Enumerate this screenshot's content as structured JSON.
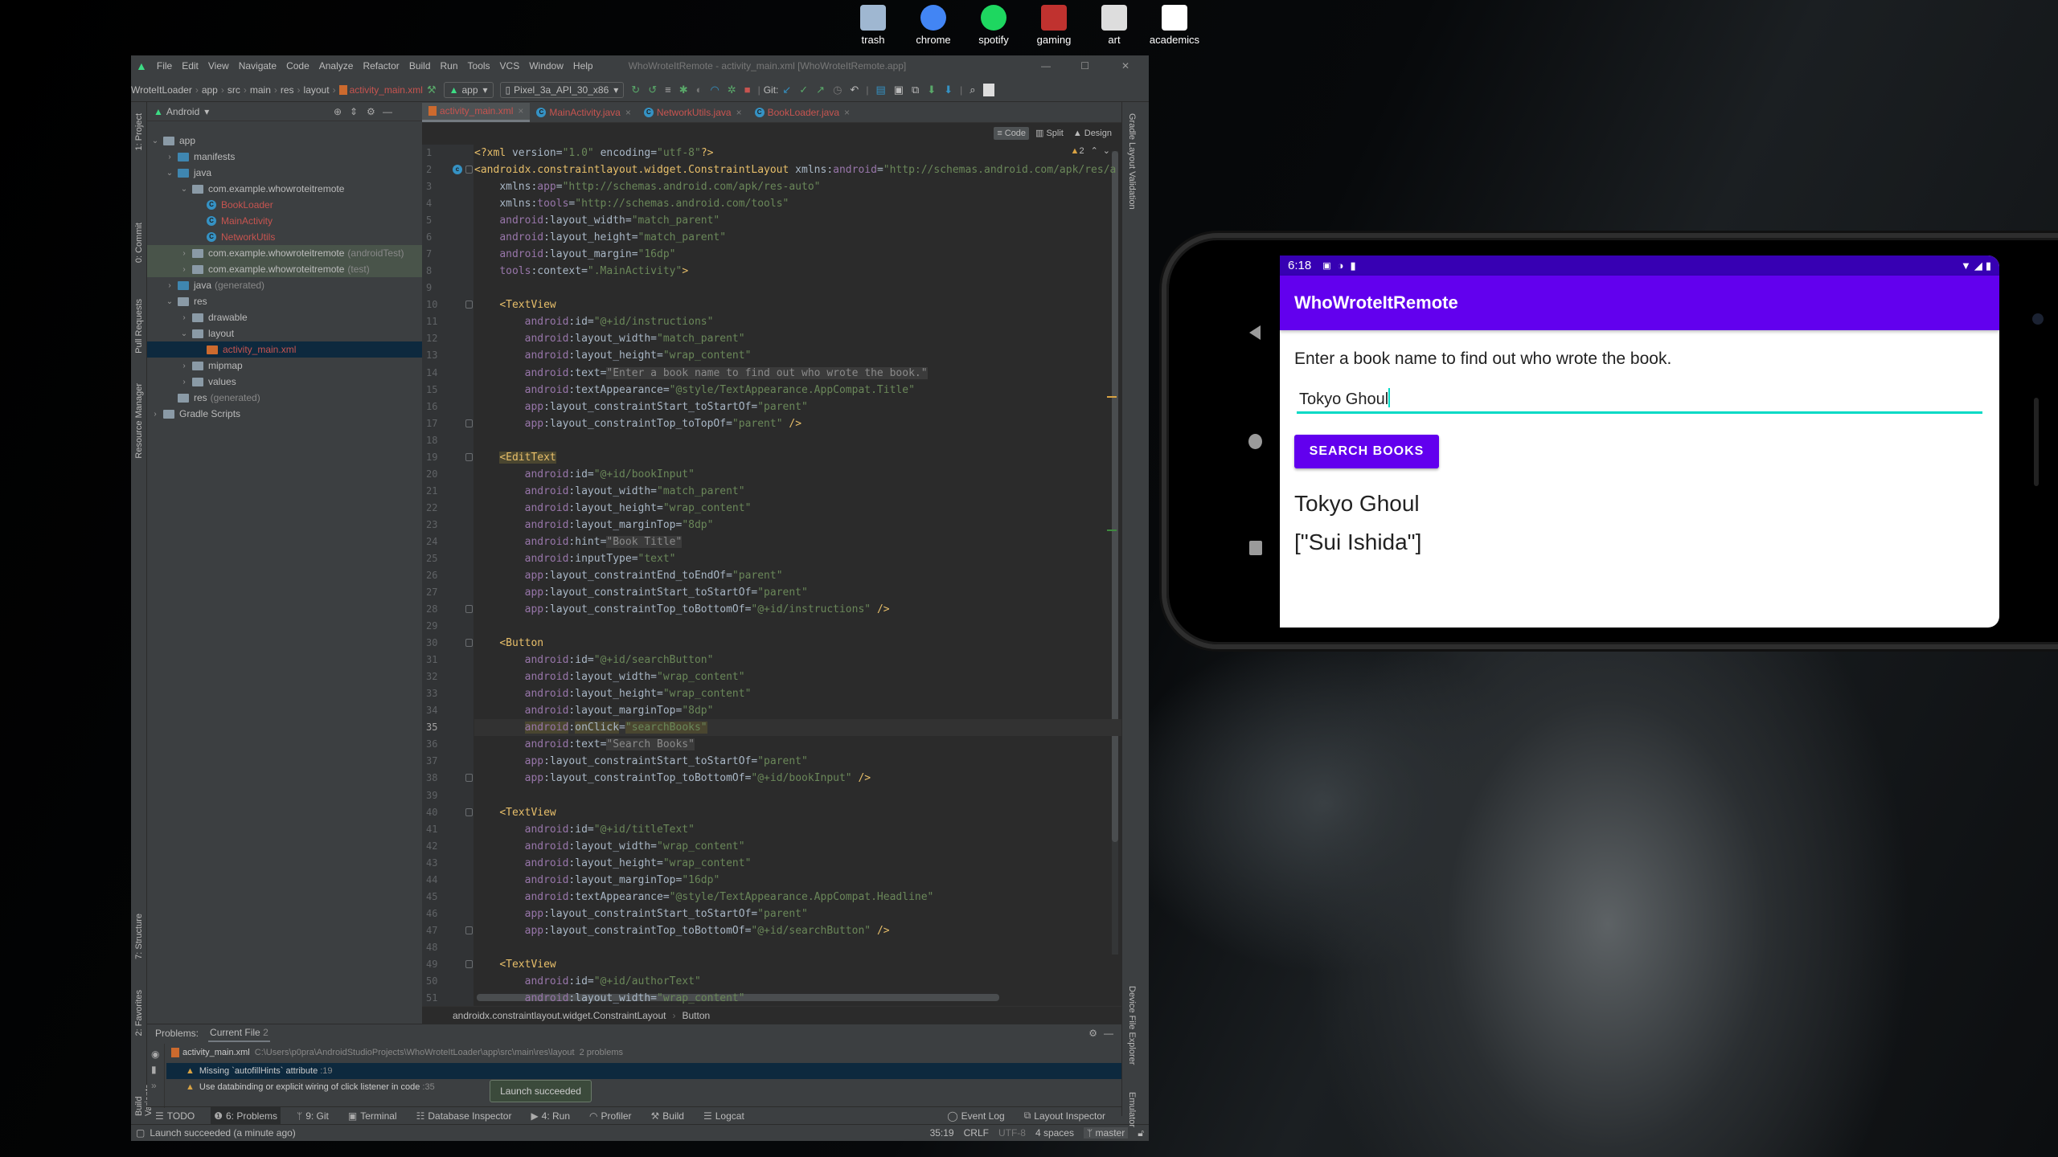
{
  "desktop": {
    "icons": [
      {
        "label": "trash",
        "color": "#9fb7d1"
      },
      {
        "label": "chrome",
        "color": "#4285f4"
      },
      {
        "label": "spotify",
        "color": "#1ed760"
      },
      {
        "label": "gaming",
        "color": "#c0322f"
      },
      {
        "label": "art",
        "color": "#dddddd"
      },
      {
        "label": "academics",
        "color": "#ffffff"
      }
    ]
  },
  "ide": {
    "window_title": "WhoWroteItRemote - activity_main.xml [WhoWroteItRemote.app]",
    "menu": [
      "File",
      "Edit",
      "View",
      "Navigate",
      "Code",
      "Analyze",
      "Refactor",
      "Build",
      "Run",
      "Tools",
      "VCS",
      "Window",
      "Help"
    ],
    "breadcrumb": [
      "WroteItLoader",
      "app",
      "src",
      "main",
      "res",
      "layout",
      "activity_main.xml"
    ],
    "run_config": "app",
    "device": "Pixel_3a_API_30_x86",
    "git_label": "Git:",
    "project_view": "Android",
    "left_strip": {
      "top": [
        "1: Project",
        "0: Commit",
        "Pull Requests",
        "Resource Manager"
      ],
      "bottom": [
        "7: Structure",
        "2: Favorites",
        "Build Variants"
      ]
    },
    "right_strip": {
      "top": [
        "Gradle",
        "Layout Validation"
      ],
      "bottom": [
        "Device File Explorer",
        "Emulator"
      ]
    },
    "tree": [
      {
        "label": "app",
        "suffix": "",
        "level": 0,
        "chev": "open",
        "icon": "module",
        "color": "#bbbbbb"
      },
      {
        "label": "manifests",
        "suffix": "",
        "level": 1,
        "chev": "closed",
        "icon": "folder",
        "color": "#bbbbbb"
      },
      {
        "label": "java",
        "suffix": "",
        "level": 1,
        "chev": "open",
        "icon": "folder",
        "color": "#bbbbbb"
      },
      {
        "label": "com.example.whowroteitremote",
        "suffix": "",
        "level": 2,
        "chev": "open",
        "icon": "package",
        "color": "#bbbbbb"
      },
      {
        "label": "BookLoader",
        "suffix": "",
        "level": 3,
        "chev": "",
        "icon": "class",
        "color": "#c75450"
      },
      {
        "label": "MainActivity",
        "suffix": "",
        "level": 3,
        "chev": "",
        "icon": "class",
        "color": "#c75450"
      },
      {
        "label": "NetworkUtils",
        "suffix": "",
        "level": 3,
        "chev": "",
        "icon": "class",
        "color": "#c75450"
      },
      {
        "label": "com.example.whowroteitremote",
        "suffix": "(androidTest)",
        "level": 2,
        "chev": "closed",
        "icon": "package",
        "color": "#bbbbbb",
        "test": true
      },
      {
        "label": "com.example.whowroteitremote",
        "suffix": "(test)",
        "level": 2,
        "chev": "closed",
        "icon": "package",
        "color": "#bbbbbb",
        "test": true
      },
      {
        "label": "java",
        "suffix": "(generated)",
        "level": 1,
        "chev": "closed",
        "icon": "folder",
        "color": "#bbbbbb"
      },
      {
        "label": "res",
        "suffix": "",
        "level": 1,
        "chev": "open",
        "icon": "res",
        "color": "#bbbbbb"
      },
      {
        "label": "drawable",
        "suffix": "",
        "level": 2,
        "chev": "closed",
        "icon": "package",
        "color": "#bbbbbb"
      },
      {
        "label": "layout",
        "suffix": "",
        "level": 2,
        "chev": "open",
        "icon": "package",
        "color": "#bbbbbb"
      },
      {
        "label": "activity_main.xml",
        "suffix": "",
        "level": 3,
        "chev": "",
        "icon": "xml",
        "color": "#c75450",
        "selected": true
      },
      {
        "label": "mipmap",
        "suffix": "",
        "level": 2,
        "chev": "closed",
        "icon": "package",
        "color": "#bbbbbb"
      },
      {
        "label": "values",
        "suffix": "",
        "level": 2,
        "chev": "closed",
        "icon": "package",
        "color": "#bbbbbb"
      },
      {
        "label": "res",
        "suffix": "(generated)",
        "level": 1,
        "chev": "",
        "icon": "res",
        "color": "#bbbbbb"
      },
      {
        "label": "Gradle Scripts",
        "suffix": "",
        "level": 0,
        "chev": "closed",
        "icon": "gradle",
        "color": "#bbbbbb"
      }
    ],
    "tabs": [
      {
        "label": "activity_main.xml",
        "icon": "xml",
        "active": true
      },
      {
        "label": "MainActivity.java",
        "icon": "class"
      },
      {
        "label": "NetworkUtils.java",
        "icon": "class"
      },
      {
        "label": "BookLoader.java",
        "icon": "class"
      }
    ],
    "view_modes": [
      "Code",
      "Split",
      "Design"
    ],
    "warning_count": "2",
    "code_lines": [
      "<?xml version=\"1.0\" encoding=\"utf-8\"?>",
      "<androidx.constraintlayout.widget.ConstraintLayout xmlns:android=\"http://schemas.android.com/apk/res/a",
      "    xmlns:app=\"http://schemas.android.com/apk/res-auto\"",
      "    xmlns:tools=\"http://schemas.android.com/tools\"",
      "    android:layout_width=\"match_parent\"",
      "    android:layout_height=\"match_parent\"",
      "    android:layout_margin=\"16dp\"",
      "    tools:context=\".MainActivity\">",
      "",
      "    <TextView",
      "        android:id=\"@+id/instructions\"",
      "        android:layout_width=\"match_parent\"",
      "        android:layout_height=\"wrap_content\"",
      "        android:text=\"Enter a book name to find out who wrote the book.\"",
      "        android:textAppearance=\"@style/TextAppearance.AppCompat.Title\"",
      "        app:layout_constraintStart_toStartOf=\"parent\"",
      "        app:layout_constraintTop_toTopOf=\"parent\" />",
      "",
      "    <EditText",
      "        android:id=\"@+id/bookInput\"",
      "        android:layout_width=\"match_parent\"",
      "        android:layout_height=\"wrap_content\"",
      "        android:layout_marginTop=\"8dp\"",
      "        android:hint=\"Book Title\"",
      "        android:inputType=\"text\"",
      "        app:layout_constraintEnd_toEndOf=\"parent\"",
      "        app:layout_constraintStart_toStartOf=\"parent\"",
      "        app:layout_constraintTop_toBottomOf=\"@+id/instructions\" />",
      "",
      "    <Button",
      "        android:id=\"@+id/searchButton\"",
      "        android:layout_width=\"wrap_content\"",
      "        android:layout_height=\"wrap_content\"",
      "        android:layout_marginTop=\"8dp\"",
      "        android:onClick=\"searchBooks\"",
      "        android:text=\"Search Books\"",
      "        app:layout_constraintStart_toStartOf=\"parent\"",
      "        app:layout_constraintTop_toBottomOf=\"@+id/bookInput\" />",
      "",
      "    <TextView",
      "        android:id=\"@+id/titleText\"",
      "        android:layout_width=\"wrap_content\"",
      "        android:layout_height=\"wrap_content\"",
      "        android:layout_marginTop=\"16dp\"",
      "        android:textAppearance=\"@style/TextAppearance.AppCompat.Headline\"",
      "        app:layout_constraintStart_toStartOf=\"parent\"",
      "        app:layout_constraintTop_toBottomOf=\"@+id/searchButton\" />",
      "",
      "    <TextView",
      "        android:id=\"@+id/authorText\"",
      "        android:layout_width=\"wrap_content\""
    ],
    "editor_breadcrumb": [
      "androidx.constraintlayout.widget.ConstraintLayout",
      "Button"
    ],
    "problems": {
      "title": "Problems:",
      "tab": "Current File",
      "tab_count": "2",
      "file": "activity_main.xml",
      "path": "C:\\Users\\p0pra\\AndroidStudioProjects\\WhoWroteItLoader\\app\\src\\main\\res\\layout",
      "count": "2 problems",
      "items": [
        {
          "text": "Missing `autofillHints` attribute",
          "line": ":19",
          "selected": true
        },
        {
          "text": "Use databinding or explicit wiring of click listener in code",
          "line": ":35"
        }
      ]
    },
    "tooltip": "Launch succeeded",
    "bottom_tabs": [
      "TODO",
      "6: Problems",
      "9: Git",
      "Terminal",
      "Database Inspector",
      "4: Run",
      "Profiler",
      "Build",
      "Logcat"
    ],
    "bottom_tabs_right": [
      "Event Log",
      "Layout Inspector"
    ],
    "status": {
      "message": "Launch succeeded (a minute ago)",
      "position": "35:19",
      "line_sep": "CRLF",
      "encoding": "UTF-8",
      "indent": "4 spaces",
      "branch": "master"
    }
  },
  "phone": {
    "time": "6:18",
    "app_title": "WhoWroteItRemote",
    "instructions": "Enter a book name to find out who wrote the book.",
    "input_value": "Tokyo Ghoul",
    "button": "SEARCH BOOKS",
    "title_result": "Tokyo Ghoul",
    "author_result": "[\"Sui Ishida\"]",
    "colors": {
      "status": "#3700b3",
      "appbar": "#6200ee",
      "accent": "#03dac5"
    }
  }
}
